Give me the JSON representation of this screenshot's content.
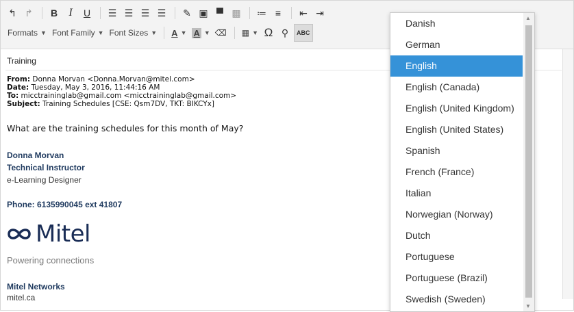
{
  "toolbar": {
    "formats_label": "Formats",
    "font_family_label": "Font Family",
    "font_sizes_label": "Font Sizes",
    "text_color_label": "A",
    "bg_color_label": "A",
    "spellcheck_label": "ABC"
  },
  "email": {
    "subject_line": "Training",
    "from_label": "From:",
    "from_value": "Donna Morvan <Donna.Morvan@mitel.com>",
    "date_label": "Date:",
    "date_value": "Tuesday, May 3, 2016, 11:44:16 AM",
    "to_label": "To:",
    "to_value": "micctraininglab@gmail.com <micctraininglab@gmail.com>",
    "subject_label": "Subject:",
    "subject_value": "Training Schedules [CSE: Qsm7DV, TKT: BIKCYx]",
    "question": "What are the training schedules for this month of May?",
    "sig_name": "Donna Morvan",
    "sig_title": "Technical Instructor",
    "sig_role": "e-Learning Designer",
    "phone": "Phone: 6135990045 ext 41807",
    "logo_text": "Mitel",
    "tagline": "Powering connections",
    "company": "Mitel Networks",
    "website": "mitel.ca"
  },
  "language_menu": {
    "items": [
      "Danish",
      "German",
      "English",
      "English (Canada)",
      "English (United Kingdom)",
      "English (United States)",
      "Spanish",
      "French (France)",
      "Italian",
      "Norwegian (Norway)",
      "Dutch",
      "Portuguese",
      "Portuguese (Brazil)",
      "Swedish (Sweden)"
    ],
    "selected": "English"
  },
  "colors": {
    "accent": "#3592d8",
    "brand_navy": "#1a2d56"
  }
}
